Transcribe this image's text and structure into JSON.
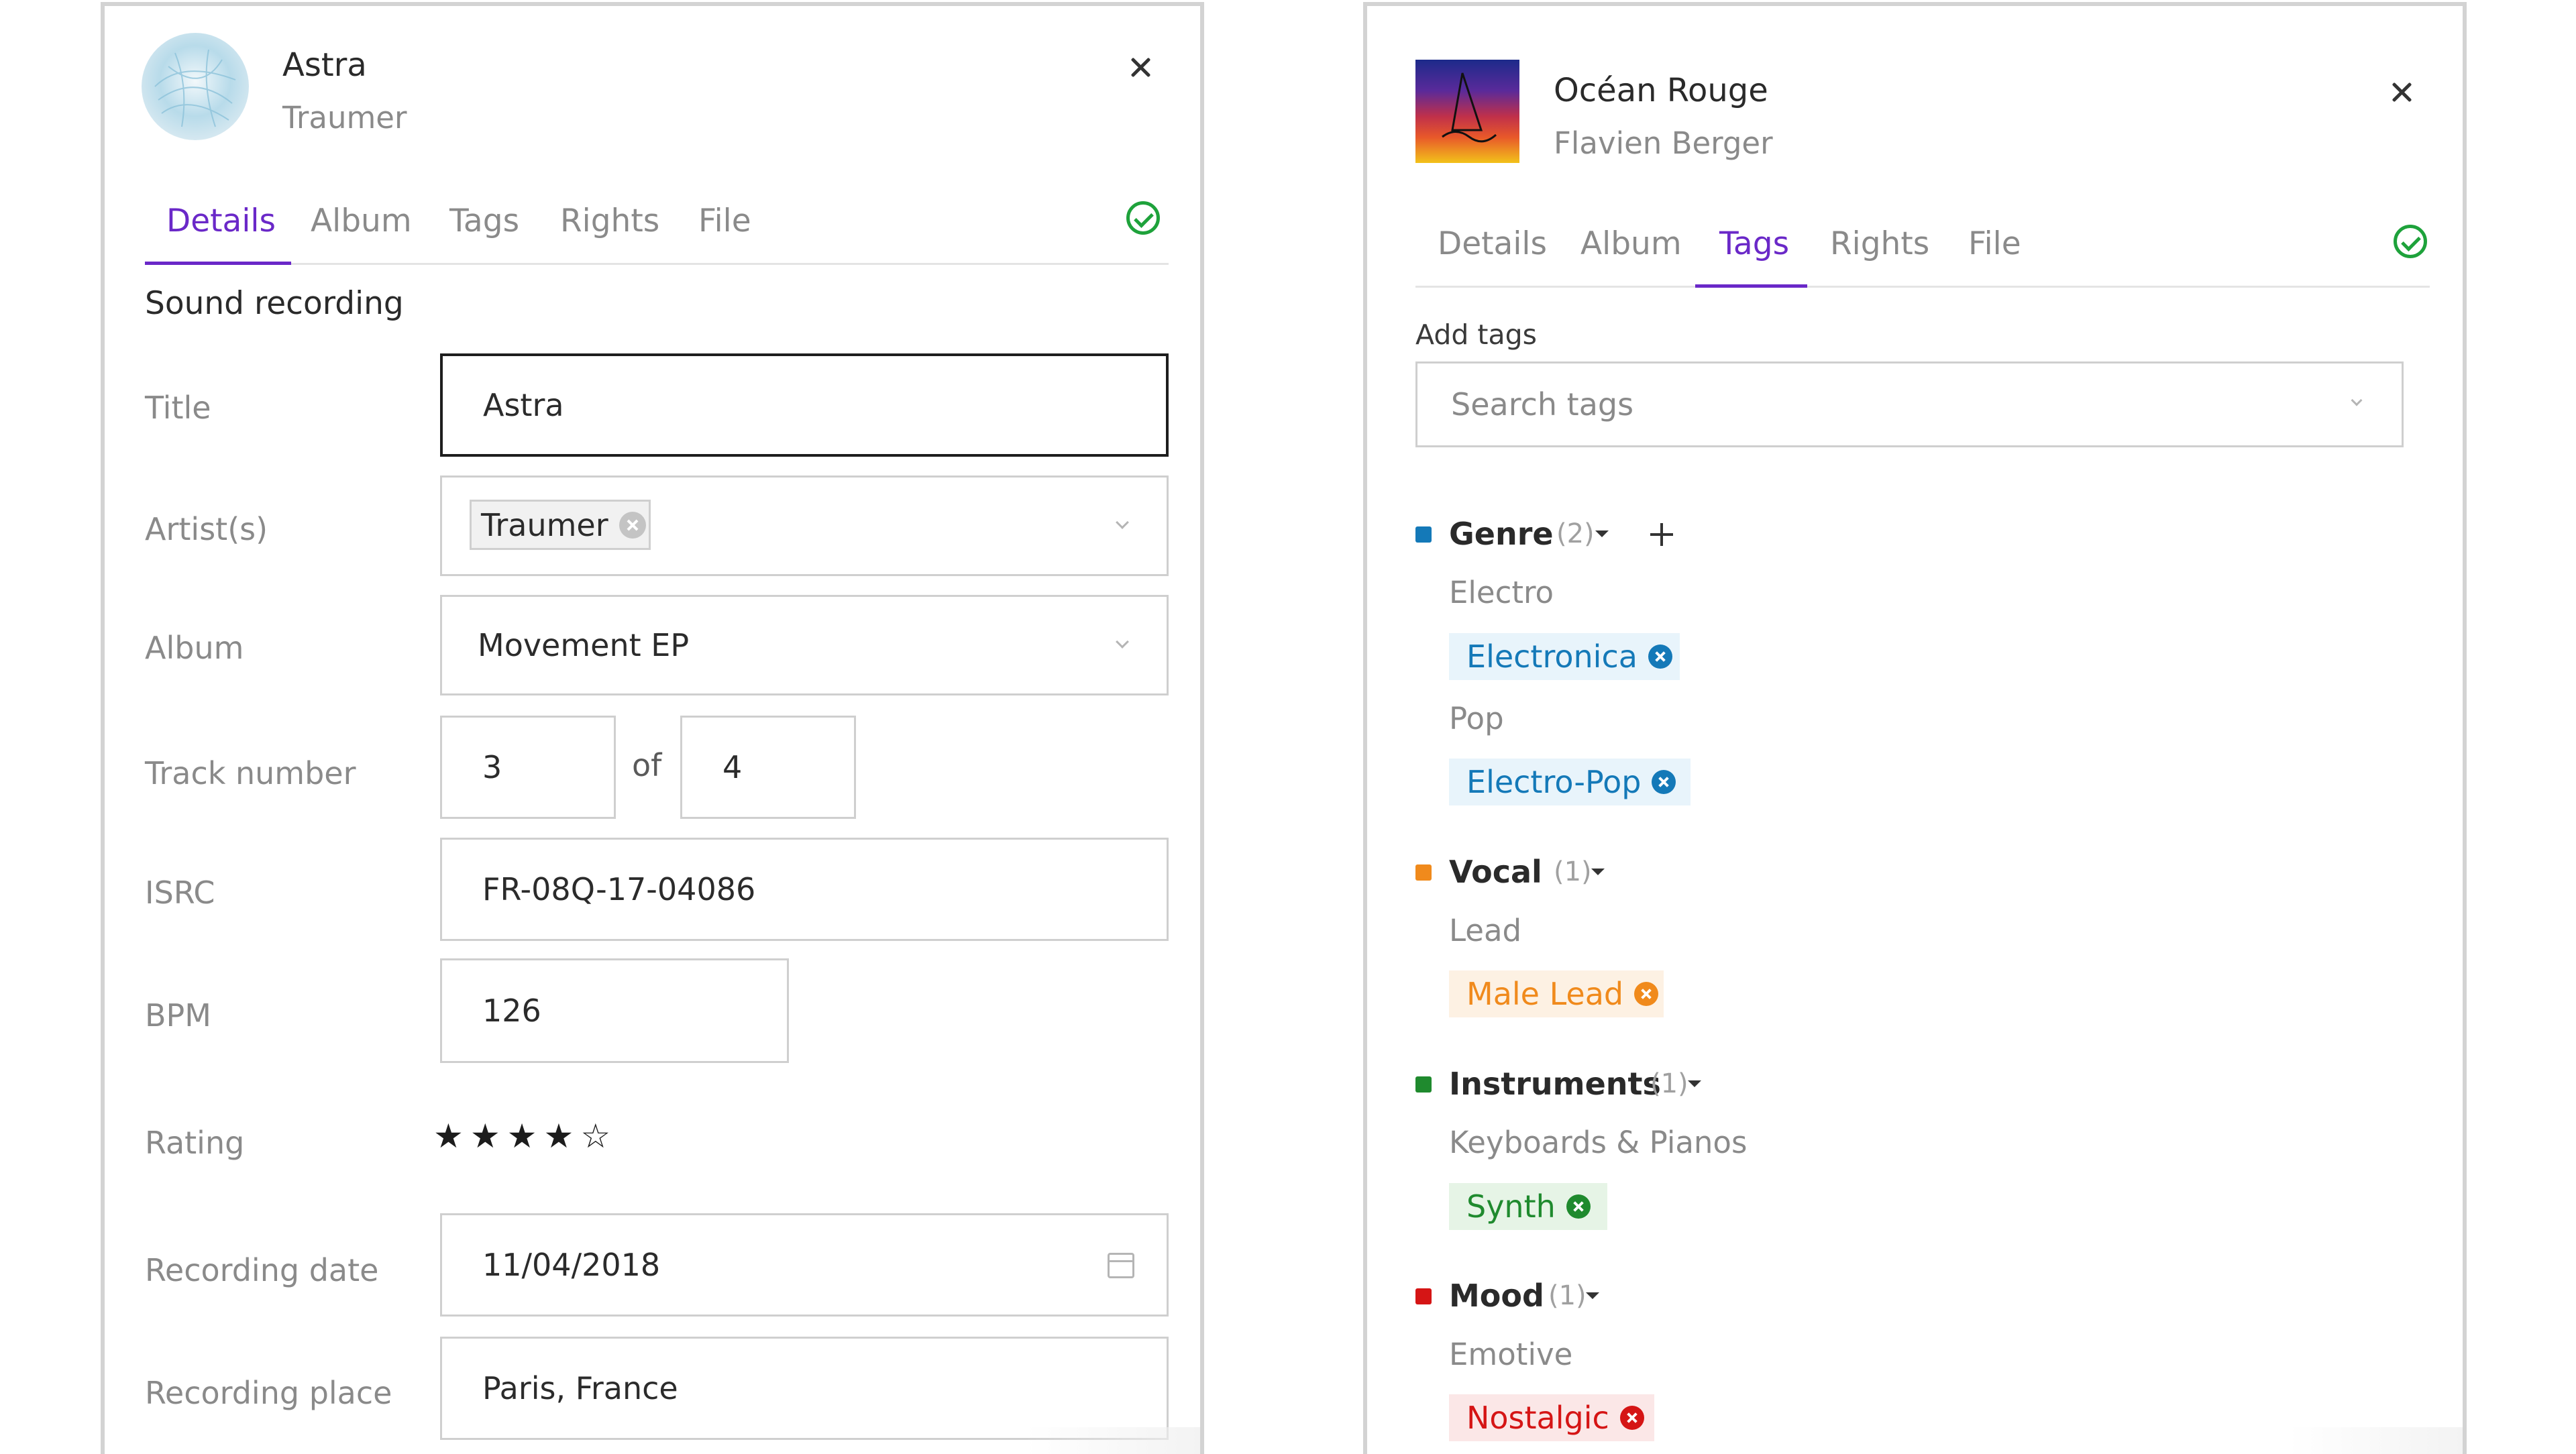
{
  "left_panel": {
    "header": {
      "title": "Astra",
      "subtitle": "Traumer"
    },
    "tabs": [
      {
        "label": "Details",
        "active": true
      },
      {
        "label": "Album",
        "active": false
      },
      {
        "label": "Tags",
        "active": false
      },
      {
        "label": "Rights",
        "active": false
      },
      {
        "label": "File",
        "active": false
      }
    ],
    "section_title": "Sound recording",
    "fields": {
      "title": {
        "label": "Title",
        "value": "Astra"
      },
      "artists": {
        "label": "Artist(s)",
        "chip": "Traumer"
      },
      "album": {
        "label": "Album",
        "value": "Movement EP"
      },
      "track": {
        "label": "Track number",
        "number": "3",
        "of_label": "of",
        "total": "4"
      },
      "isrc": {
        "label": "ISRC",
        "value": "FR-08Q-17-04086"
      },
      "bpm": {
        "label": "BPM",
        "value": "126"
      },
      "rating": {
        "label": "Rating",
        "value": 4,
        "max": 5
      },
      "recording_date": {
        "label": "Recording date",
        "value": "11/04/2018"
      },
      "recording_place": {
        "label": "Recording place",
        "value": "Paris, France"
      }
    },
    "icons": {
      "close": "close-icon",
      "status": "check-circle-icon",
      "calendar": "calendar-icon",
      "dropdown": "chevron-down-icon"
    }
  },
  "right_panel": {
    "header": {
      "title": "Océan Rouge",
      "subtitle": "Flavien Berger"
    },
    "tabs": [
      {
        "label": "Details",
        "active": false
      },
      {
        "label": "Album",
        "active": false
      },
      {
        "label": "Tags",
        "active": true
      },
      {
        "label": "Rights",
        "active": false
      },
      {
        "label": "File",
        "active": false
      }
    ],
    "add_tags_label": "Add tags",
    "search_placeholder": "Search tags",
    "categories": [
      {
        "name": "Genre",
        "count": "(2)",
        "color": "#1479b8",
        "groups": [
          {
            "subcategory": "Electro",
            "tag": "Electronica"
          },
          {
            "subcategory": "Pop",
            "tag": "Electro-Pop"
          }
        ]
      },
      {
        "name": "Vocal",
        "count": "(1)",
        "color": "#f08a1c",
        "groups": [
          {
            "subcategory": "Lead",
            "tag": "Male Lead"
          }
        ]
      },
      {
        "name": "Instruments",
        "count": "(1)",
        "color": "#1f8a2e",
        "groups": [
          {
            "subcategory": "Keyboards & Pianos",
            "tag": "Synth"
          }
        ]
      },
      {
        "name": "Mood",
        "count": "(1)",
        "color": "#d51515",
        "groups": [
          {
            "subcategory": "Emotive",
            "tag": "Nostalgic"
          }
        ]
      }
    ],
    "colors": {
      "genre_chip_bg": "#e8f4fb",
      "vocal_chip_bg": "#fdf1e3",
      "instruments_chip_bg": "#e6f4e6",
      "mood_chip_bg": "#fbe7e7",
      "accent": "#6a28c8",
      "success": "#1ea23b"
    }
  }
}
